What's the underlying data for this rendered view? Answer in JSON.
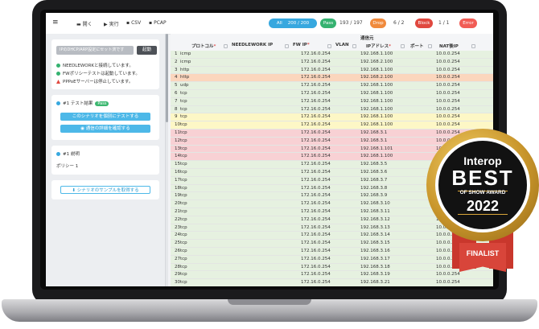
{
  "toolbar": {
    "menu_icon": "≡",
    "open_label": "開く",
    "run_label": "実行",
    "csv_label": "CSV",
    "pcap_label": "PCAP",
    "all_label": "All",
    "all_count": "200 / 200",
    "pass_label": "Pass",
    "pass_count": "193 / 197",
    "drop_label": "Drop",
    "drop_count": "6 / 2",
    "block_label": "Block",
    "block_count": "1 / 1",
    "error_label": "Error",
    "colors": {
      "all": "#37a8df",
      "pass": "#35b270",
      "drop": "#f08a3c",
      "block": "#e0483f",
      "error": "#f15c55"
    }
  },
  "sidebar": {
    "ip_placeholder": "IPのDHCP/ARP設定にセット済です",
    "ip_button": "起動",
    "messages": [
      {
        "text": "NEEDLEWORKと接続しています。",
        "status": "ok"
      },
      {
        "text": "FWポリシーテストは起動しています。",
        "status": "ok"
      },
      {
        "text": "PPPoEサーバーは停止しています。",
        "status": "warn"
      }
    ],
    "result_title": "#1 テスト結果",
    "result_tag": "Pass",
    "btn_retest": "このシナリオを個別にテストする",
    "btn_detail": "通信の詳細を確認する",
    "desc_title": "#1 説明",
    "desc_text": "ポリシー 1",
    "btn_sample": "シナリオのサンプルを取得する"
  },
  "table": {
    "group_header": "通信元",
    "headers": [
      "プロトコル",
      "NEEDLEWORK IP",
      "FW IP",
      "VLAN",
      "IPアドレス",
      "ポート",
      "NAT後IP"
    ],
    "rows": [
      {
        "n": "1",
        "p": "icmp",
        "fw": "172.16.0.254",
        "ip": "192.168.1.100",
        "nat": "10.0.0.254",
        "s": "pass"
      },
      {
        "n": "2",
        "p": "icmp",
        "fw": "172.16.0.254",
        "ip": "192.168.2.100",
        "nat": "10.0.0.254",
        "s": "pass"
      },
      {
        "n": "3",
        "p": "http",
        "fw": "172.16.0.254",
        "ip": "192.168.1.100",
        "nat": "10.0.0.254",
        "s": "pass"
      },
      {
        "n": "4",
        "p": "http",
        "fw": "172.16.0.254",
        "ip": "192.168.2.100",
        "nat": "10.0.0.254",
        "s": "drop"
      },
      {
        "n": "5",
        "p": "udp",
        "fw": "172.16.0.254",
        "ip": "192.168.1.100",
        "nat": "10.0.0.254",
        "s": "pass"
      },
      {
        "n": "6",
        "p": "tcp",
        "fw": "172.16.0.254",
        "ip": "192.168.1.100",
        "nat": "10.0.0.254",
        "s": "pass"
      },
      {
        "n": "7",
        "p": "tcp",
        "fw": "172.16.0.254",
        "ip": "192.168.1.100",
        "nat": "10.0.0.254",
        "s": "pass"
      },
      {
        "n": "8",
        "p": "tcp",
        "fw": "172.16.0.254",
        "ip": "192.168.1.100",
        "nat": "10.0.0.254",
        "s": "pass"
      },
      {
        "n": "9",
        "p": "tcp",
        "fw": "172.16.0.254",
        "ip": "192.168.1.100",
        "nat": "10.0.0.254",
        "s": "warn"
      },
      {
        "n": "10",
        "p": "tcp",
        "fw": "172.16.0.254",
        "ip": "192.168.1.100",
        "nat": "10.0.0.254",
        "s": "warn"
      },
      {
        "n": "11",
        "p": "tcp",
        "fw": "172.16.0.254",
        "ip": "192.168.3.1",
        "nat": "10.0.0.254",
        "s": "block"
      },
      {
        "n": "12",
        "p": "tcp",
        "fw": "172.16.0.254",
        "ip": "192.168.3.1",
        "nat": "10.0.0.254",
        "s": "block"
      },
      {
        "n": "13",
        "p": "tcp",
        "fw": "172.16.0.254",
        "ip": "192.168.1.101",
        "nat": "10.0.0.254",
        "s": "block"
      },
      {
        "n": "14",
        "p": "tcp",
        "fw": "172.16.0.254",
        "ip": "192.168.1.100",
        "nat": "10.0.0.254",
        "s": "block"
      },
      {
        "n": "15",
        "p": "tcp",
        "fw": "172.16.0.254",
        "ip": "192.168.3.5",
        "nat": "10.0.0.254",
        "s": "pass"
      },
      {
        "n": "16",
        "p": "tcp",
        "fw": "172.16.0.254",
        "ip": "192.168.3.6",
        "nat": "10.0.0.254",
        "s": "pass"
      },
      {
        "n": "17",
        "p": "tcp",
        "fw": "172.16.0.254",
        "ip": "192.168.3.7",
        "nat": "10.0.0.254",
        "s": "pass"
      },
      {
        "n": "18",
        "p": "tcp",
        "fw": "172.16.0.254",
        "ip": "192.168.3.8",
        "nat": "10.0.0.254",
        "s": "pass"
      },
      {
        "n": "19",
        "p": "tcp",
        "fw": "172.16.0.254",
        "ip": "192.168.3.9",
        "nat": "10.0.0.254",
        "s": "pass"
      },
      {
        "n": "20",
        "p": "tcp",
        "fw": "172.16.0.254",
        "ip": "192.168.3.10",
        "nat": "10.0.0.254",
        "s": "pass"
      },
      {
        "n": "21",
        "p": "tcp",
        "fw": "172.16.0.254",
        "ip": "192.168.3.11",
        "nat": "10.0.0.254",
        "s": "pass"
      },
      {
        "n": "22",
        "p": "tcp",
        "fw": "172.16.0.254",
        "ip": "192.168.3.12",
        "nat": "10.0.0.254",
        "s": "pass"
      },
      {
        "n": "23",
        "p": "tcp",
        "fw": "172.16.0.254",
        "ip": "192.168.3.13",
        "nat": "10.0.0.254",
        "s": "pass"
      },
      {
        "n": "24",
        "p": "tcp",
        "fw": "172.16.0.254",
        "ip": "192.168.3.14",
        "nat": "10.0.0.254",
        "s": "pass"
      },
      {
        "n": "25",
        "p": "tcp",
        "fw": "172.16.0.254",
        "ip": "192.168.3.15",
        "nat": "10.0.0.254",
        "s": "pass"
      },
      {
        "n": "26",
        "p": "tcp",
        "fw": "172.16.0.254",
        "ip": "192.168.3.16",
        "nat": "10.0.0.254",
        "s": "pass"
      },
      {
        "n": "27",
        "p": "tcp",
        "fw": "172.16.0.254",
        "ip": "192.168.3.17",
        "nat": "10.0.0.254",
        "s": "pass"
      },
      {
        "n": "28",
        "p": "tcp",
        "fw": "172.16.0.254",
        "ip": "192.168.3.18",
        "nat": "10.0.0.254",
        "s": "pass"
      },
      {
        "n": "29",
        "p": "tcp",
        "fw": "172.16.0.254",
        "ip": "192.168.3.19",
        "nat": "10.0.0.254",
        "s": "pass"
      },
      {
        "n": "30",
        "p": "tcp",
        "fw": "172.16.0.254",
        "ip": "192.168.3.21",
        "nat": "10.0.0.254",
        "s": "pass"
      }
    ],
    "row_colors": {
      "pass": "#e6f1e0",
      "drop": "#fbd6bd",
      "warn": "#fdf7c6",
      "block": "#f8d1d4"
    }
  },
  "badge": {
    "brand": "Interop",
    "title": "BEST",
    "subtitle": "OF SHOW AWARD",
    "year": "2022",
    "ribbon": "FINALIST"
  }
}
